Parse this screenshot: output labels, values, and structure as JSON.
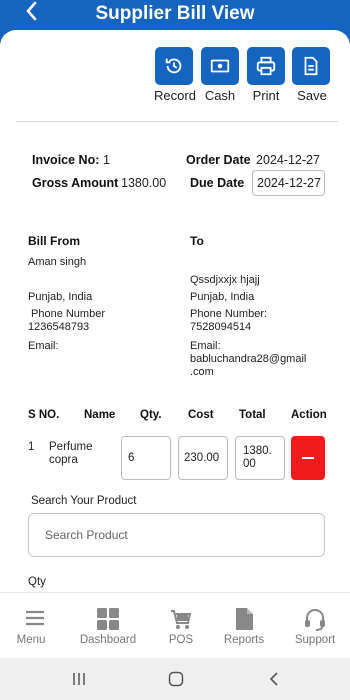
{
  "header": {
    "title": "Supplier Bill View",
    "back_icon": "chevron-left-icon"
  },
  "actions": [
    {
      "label": "Record",
      "icon": "history-icon"
    },
    {
      "label": "Cash",
      "icon": "cash-icon"
    },
    {
      "label": "Print",
      "icon": "printer-icon"
    },
    {
      "label": "Save",
      "icon": "document-icon"
    }
  ],
  "invoice": {
    "invoice_no_label": "Invoice No:",
    "invoice_no": "1",
    "order_date_label": "Order Date",
    "order_date": "2024-12-27",
    "gross_amount_label": "Gross Amount",
    "gross_amount": "1380.00",
    "due_date_label": "Due Date",
    "due_date": "2024-12-27"
  },
  "bill_from": {
    "heading": "Bill From",
    "name": "Aman singh",
    "location": "Punjab, India",
    "phone_label": "Phone Number",
    "phone": "1236548793",
    "email_label": "Email:"
  },
  "bill_to": {
    "heading": "To",
    "name": "Qssdjxxjx hjajj",
    "location": "Punjab, India",
    "phone_label": "Phone Number:",
    "phone": "7528094514",
    "email_label": "Email:",
    "email_line1": "babluchandra28@gmail",
    "email_line2": ".com"
  },
  "items_table": {
    "headers": [
      "S NO.",
      "Name",
      "Qty.",
      "Cost",
      "Total",
      "Action"
    ],
    "rows": [
      {
        "sno": "1",
        "name_line1": "Perfume",
        "name_line2": "copra",
        "qty": "6",
        "cost": "230.00",
        "total_line1": "1380.",
        "total_line2": "00"
      }
    ]
  },
  "search": {
    "label": "Search Your Product",
    "placeholder": "Search Product"
  },
  "qty_label": "Qty",
  "bottom_nav": [
    {
      "label": "Menu",
      "icon": "menu-icon"
    },
    {
      "label": "Dashboard",
      "icon": "dashboard-icon"
    },
    {
      "label": "POS",
      "icon": "cart-icon"
    },
    {
      "label": "Reports",
      "icon": "report-icon"
    },
    {
      "label": "Support",
      "icon": "headset-icon"
    }
  ],
  "colors": {
    "primary": "#1565c0",
    "danger": "#f21b1b",
    "nav_icon": "#888888"
  }
}
